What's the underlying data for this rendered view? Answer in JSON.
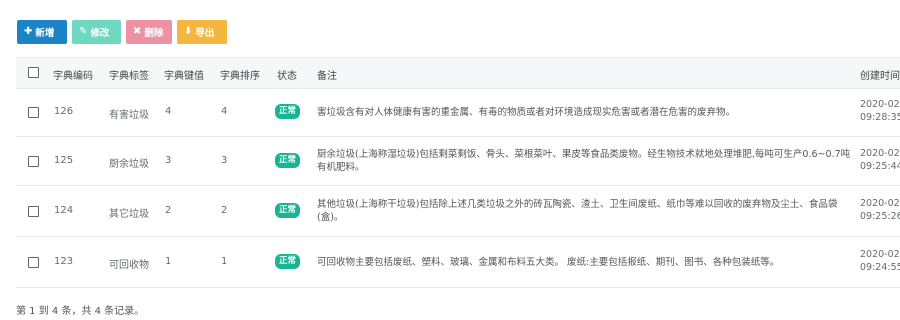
{
  "toolbar": {
    "add_label": "新增",
    "edit_label": "修改",
    "delete_label": "删除",
    "export_label": "导出"
  },
  "table": {
    "headers": {
      "code": "字典编码",
      "label": "字典标签",
      "value": "字典键值",
      "sort": "字典排序",
      "status": "状态",
      "remark": "备注",
      "created": "创建时间"
    },
    "rows": [
      {
        "code": "126",
        "label": "有害垃圾",
        "value": "4",
        "sort": "4",
        "status": "正常",
        "remark": "害垃圾含有对人体健康有害的重金属、有毒的物质或者对环境造成现实危害或者潜在危害的废弃物。",
        "created_date": "2020-02",
        "created_time": "09:28:35"
      },
      {
        "code": "125",
        "label": "厨余垃圾",
        "value": "3",
        "sort": "3",
        "status": "正常",
        "remark": "厨余垃圾(上海称湿垃圾)包括剩菜剩饭、骨头、菜根菜叶、果皮等食品类废物。经生物技术就地处理堆肥,每吨可生产0.6~0.7吨有机肥料。",
        "created_date": "2020-02",
        "created_time": "09:25:44"
      },
      {
        "code": "124",
        "label": "其它垃圾",
        "value": "2",
        "sort": "2",
        "status": "正常",
        "remark": "其他垃圾(上海称干垃圾)包括除上述几类垃圾之外的砖瓦陶瓷、渣土、卫生间废纸、纸巾等难以回收的废弃物及尘土、食品袋(盒)。",
        "created_date": "2020-02",
        "created_time": "09:25:26"
      },
      {
        "code": "123",
        "label": "可回收物",
        "value": "1",
        "sort": "1",
        "status": "正常",
        "remark": "可回收物主要包括废纸、塑料、玻璃、金属和布料五大类。 废纸:主要包括报纸、期刊、图书、各种包装纸等。",
        "created_date": "2020-02",
        "created_time": "09:24:55"
      }
    ]
  },
  "footer": {
    "summary": "第 1 到 4 条，共 4 条记录。"
  }
}
